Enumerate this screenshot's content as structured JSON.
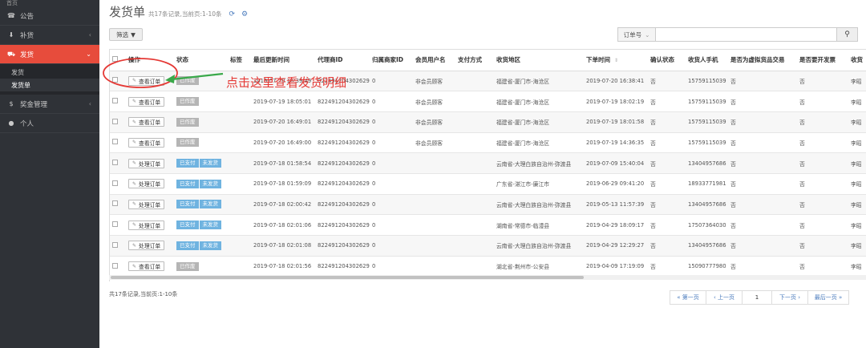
{
  "sidebar": {
    "top_item": "首页",
    "items": [
      {
        "label": "公告",
        "icon": "megaphone-icon"
      },
      {
        "label": "补货",
        "icon": "download-icon"
      },
      {
        "label": "发货",
        "icon": "truck-icon",
        "active": true
      },
      {
        "label": "奖金管理",
        "icon": "dollar-icon"
      },
      {
        "label": "个人",
        "icon": "user-icon"
      }
    ],
    "submenu": [
      "发货",
      "发货单"
    ]
  },
  "header": {
    "title": "发货单",
    "subtitle": "共17条记录,当前页:1-10条"
  },
  "toolbar": {
    "filter_label": "筛选",
    "search_field": "订单号",
    "search_value": ""
  },
  "table": {
    "columns": [
      "操作",
      "状态",
      "标签",
      "最后更新时间",
      "代理商ID",
      "归属商家ID",
      "会员用户名",
      "支付方式",
      "收货地区",
      "下单时间",
      "确认状态",
      "收货人手机",
      "是否为虚拟货品交易",
      "是否要开发票",
      "收货"
    ],
    "rows": [
      {
        "action": "查看订单",
        "tags": [
          "已作废"
        ],
        "updated": "2019-07-20 16:39:49",
        "agent": "8224912043026298",
        "merchant": "0",
        "member": "非会员顾客",
        "pay": "",
        "region": "福建省-厦门市-海沧区",
        "ordered": "2019-07-20 16:38:41",
        "confirm": "否",
        "phone": "15759115039",
        "virtual": "否",
        "invoice": "否",
        "receiver": "李昭"
      },
      {
        "action": "查看订单",
        "tags": [
          "已作废"
        ],
        "updated": "2019-07-19 18:05:01",
        "agent": "8224912043026298",
        "merchant": "0",
        "member": "非会员顾客",
        "pay": "",
        "region": "福建省-厦门市-海沧区",
        "ordered": "2019-07-19 18:02:19",
        "confirm": "否",
        "phone": "15759115039",
        "virtual": "否",
        "invoice": "否",
        "receiver": "李昭"
      },
      {
        "action": "查看订单",
        "tags": [
          "已作废"
        ],
        "updated": "2019-07-20 16:49:01",
        "agent": "8224912043026298",
        "merchant": "0",
        "member": "非会员顾客",
        "pay": "",
        "region": "福建省-厦门市-海沧区",
        "ordered": "2019-07-19 18:01:58",
        "confirm": "否",
        "phone": "15759115039",
        "virtual": "否",
        "invoice": "否",
        "receiver": "李昭"
      },
      {
        "action": "查看订单",
        "tags": [
          "已作废"
        ],
        "updated": "2019-07-20 16:49:00",
        "agent": "8224912043026298",
        "merchant": "0",
        "member": "非会员顾客",
        "pay": "",
        "region": "福建省-厦门市-海沧区",
        "ordered": "2019-07-19 14:36:35",
        "confirm": "否",
        "phone": "15759115039",
        "virtual": "否",
        "invoice": "否",
        "receiver": "李昭"
      },
      {
        "action": "处理订单",
        "tags": [
          "已支付",
          "未发货"
        ],
        "updated": "2019-07-18 01:58:54",
        "agent": "8224912043026298",
        "merchant": "0",
        "member": "",
        "pay": "",
        "region": "云南省-大理白族自治州-弥渡县",
        "ordered": "2019-07-09 15:40:04",
        "confirm": "否",
        "phone": "13404957686",
        "virtual": "否",
        "invoice": "否",
        "receiver": "李昭"
      },
      {
        "action": "处理订单",
        "tags": [
          "已支付",
          "未发货"
        ],
        "updated": "2019-07-18 01:59:09",
        "agent": "8224912043026298",
        "merchant": "0",
        "member": "",
        "pay": "",
        "region": "广东省-湛江市-廉江市",
        "ordered": "2019-06-29 09:41:20",
        "confirm": "否",
        "phone": "18933771981",
        "virtual": "否",
        "invoice": "否",
        "receiver": "李昭"
      },
      {
        "action": "处理订单",
        "tags": [
          "已支付",
          "未发货"
        ],
        "updated": "2019-07-18 02:00:42",
        "agent": "8224912043026298",
        "merchant": "0",
        "member": "",
        "pay": "",
        "region": "云南省-大理白族自治州-弥渡县",
        "ordered": "2019-05-13 11:57:39",
        "confirm": "否",
        "phone": "13404957686",
        "virtual": "否",
        "invoice": "否",
        "receiver": "李昭"
      },
      {
        "action": "处理订单",
        "tags": [
          "已支付",
          "未发货"
        ],
        "updated": "2019-07-18 02:01:06",
        "agent": "8224912043026298",
        "merchant": "0",
        "member": "",
        "pay": "",
        "region": "湖南省-常德市-临澧县",
        "ordered": "2019-04-29 18:09:17",
        "confirm": "否",
        "phone": "17507364030",
        "virtual": "否",
        "invoice": "否",
        "receiver": "李昭"
      },
      {
        "action": "处理订单",
        "tags": [
          "已支付",
          "未发货"
        ],
        "updated": "2019-07-18 02:01:08",
        "agent": "8224912043026298",
        "merchant": "0",
        "member": "",
        "pay": "",
        "region": "云南省-大理白族自治州-弥渡县",
        "ordered": "2019-04-29 12:29:27",
        "confirm": "否",
        "phone": "13404957686",
        "virtual": "否",
        "invoice": "否",
        "receiver": "李昭"
      },
      {
        "action": "查看订单",
        "tags": [
          "已作废"
        ],
        "updated": "2019-07-18 02:01:56",
        "agent": "8224912043026298",
        "merchant": "0",
        "member": "",
        "pay": "",
        "region": "湖北省-荆州市-公安县",
        "ordered": "2019-04-09 17:19:09",
        "confirm": "否",
        "phone": "15090777980",
        "virtual": "否",
        "invoice": "否",
        "receiver": "李昭"
      }
    ]
  },
  "footer": {
    "summary": "共17条记录,当前页:1-10条",
    "pager": {
      "first": "« 第一页",
      "prev": "‹ 上一页",
      "current": "1",
      "next": "下一页 ›",
      "last": "最后一页 »"
    }
  },
  "annotation": {
    "text": "点击这里查看发货明细",
    "color": "#e53935"
  }
}
